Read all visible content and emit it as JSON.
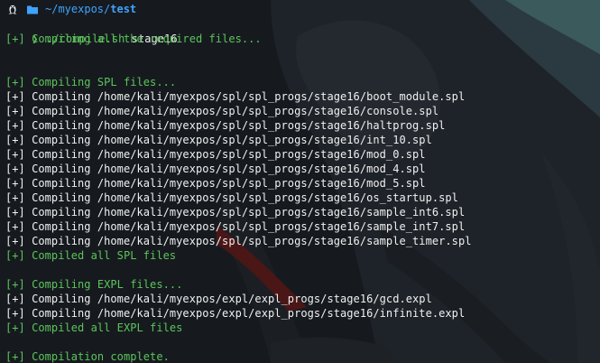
{
  "prompt": {
    "path_prefix": "~/myexpos/",
    "path_current": "test",
    "arrow": "❯",
    "command": "./compile.sh",
    "argument": " stage16"
  },
  "output": [
    {
      "type": "text",
      "color": "green",
      "text": "[+] Compiling all the required files..."
    },
    {
      "type": "gap"
    },
    {
      "type": "gap"
    },
    {
      "type": "text",
      "color": "green",
      "text": "[+] Compiling SPL files..."
    },
    {
      "type": "text",
      "color": "white",
      "text": "[+] Compiling /home/kali/myexpos/spl/spl_progs/stage16/boot_module.spl"
    },
    {
      "type": "text",
      "color": "white",
      "text": "[+] Compiling /home/kali/myexpos/spl/spl_progs/stage16/console.spl"
    },
    {
      "type": "text",
      "color": "white",
      "text": "[+] Compiling /home/kali/myexpos/spl/spl_progs/stage16/haltprog.spl"
    },
    {
      "type": "text",
      "color": "white",
      "text": "[+] Compiling /home/kali/myexpos/spl/spl_progs/stage16/int_10.spl"
    },
    {
      "type": "text",
      "color": "white",
      "text": "[+] Compiling /home/kali/myexpos/spl/spl_progs/stage16/mod_0.spl"
    },
    {
      "type": "text",
      "color": "white",
      "text": "[+] Compiling /home/kali/myexpos/spl/spl_progs/stage16/mod_4.spl"
    },
    {
      "type": "text",
      "color": "white",
      "text": "[+] Compiling /home/kali/myexpos/spl/spl_progs/stage16/mod_5.spl"
    },
    {
      "type": "text",
      "color": "white",
      "text": "[+] Compiling /home/kali/myexpos/spl/spl_progs/stage16/os_startup.spl"
    },
    {
      "type": "text",
      "color": "white",
      "text": "[+] Compiling /home/kali/myexpos/spl/spl_progs/stage16/sample_int6.spl"
    },
    {
      "type": "text",
      "color": "white",
      "text": "[+] Compiling /home/kali/myexpos/spl/spl_progs/stage16/sample_int7.spl"
    },
    {
      "type": "text",
      "color": "white",
      "text": "[+] Compiling /home/kali/myexpos/spl/spl_progs/stage16/sample_timer.spl"
    },
    {
      "type": "text",
      "color": "green",
      "text": "[+] Compiled all SPL files"
    },
    {
      "type": "gap"
    },
    {
      "type": "text",
      "color": "green",
      "text": "[+] Compiling EXPL files..."
    },
    {
      "type": "text",
      "color": "white",
      "text": "[+] Compiling /home/kali/myexpos/expl/expl_progs/stage16/gcd.expl"
    },
    {
      "type": "text",
      "color": "white",
      "text": "[+] Compiling /home/kali/myexpos/expl/expl_progs/stage16/infinite.expl"
    },
    {
      "type": "text",
      "color": "green",
      "text": "[+] Compiled all EXPL files"
    },
    {
      "type": "gap"
    },
    {
      "type": "text",
      "color": "green",
      "text": "[+] Compilation complete."
    }
  ],
  "colors": {
    "white": "#f0f0f0",
    "green": "#5cc45a",
    "blue": "#3fa3ff",
    "background": "#161a1f"
  },
  "icons": {
    "os": "linux-tux-icon",
    "directory": "folder-icon"
  }
}
